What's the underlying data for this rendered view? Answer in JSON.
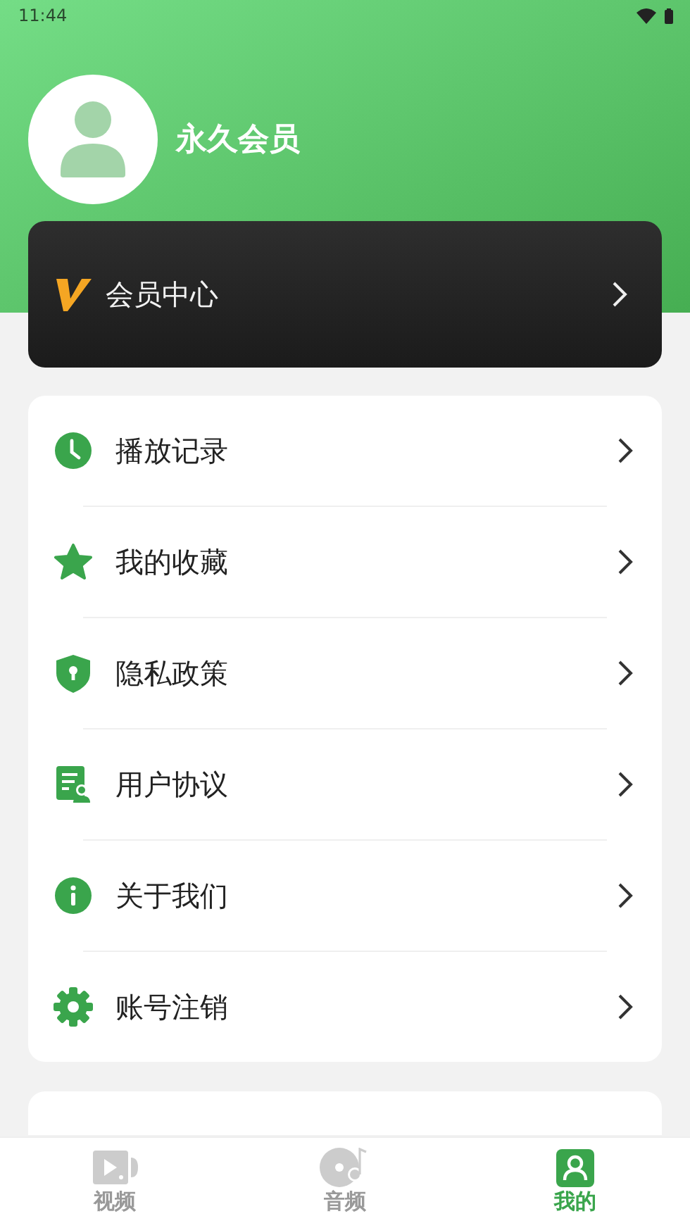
{
  "status_bar": {
    "time": "11:44"
  },
  "profile": {
    "name": "永久会员"
  },
  "vip_card": {
    "label": "会员中心"
  },
  "menu": [
    {
      "kind": "clock",
      "label": "播放记录"
    },
    {
      "kind": "star",
      "label": "我的收藏"
    },
    {
      "kind": "shield",
      "label": "隐私政策"
    },
    {
      "kind": "document",
      "label": "用户协议"
    },
    {
      "kind": "info",
      "label": "关于我们"
    },
    {
      "kind": "gear",
      "label": "账号注销"
    }
  ],
  "tab_bar": [
    {
      "kind": "video",
      "label": "视频",
      "selected": false
    },
    {
      "kind": "audio",
      "label": "音频",
      "selected": false
    },
    {
      "kind": "profile",
      "label": "我的",
      "selected": true
    }
  ]
}
